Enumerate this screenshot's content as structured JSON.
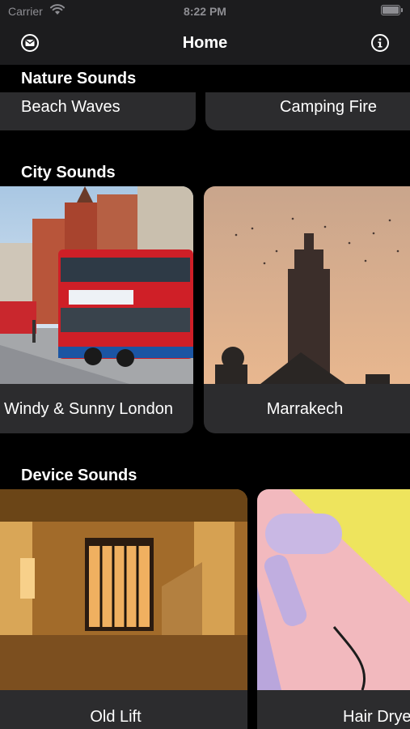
{
  "status": {
    "carrier": "Carrier",
    "time": "8:22 PM"
  },
  "nav": {
    "title": "Home",
    "left_icon": "mail-icon",
    "right_icon": "info-icon"
  },
  "sections": [
    {
      "title": "Nature Sounds",
      "cards": [
        {
          "label": "Beach Waves"
        },
        {
          "label": "Camping Fire"
        }
      ]
    },
    {
      "title": "City Sounds",
      "cards": [
        {
          "label": "Windy & Sunny London"
        },
        {
          "label": "Marrakech"
        }
      ]
    },
    {
      "title": "Device Sounds",
      "cards": [
        {
          "label": "Old Lift"
        },
        {
          "label": "Hair Dryer"
        }
      ]
    }
  ]
}
